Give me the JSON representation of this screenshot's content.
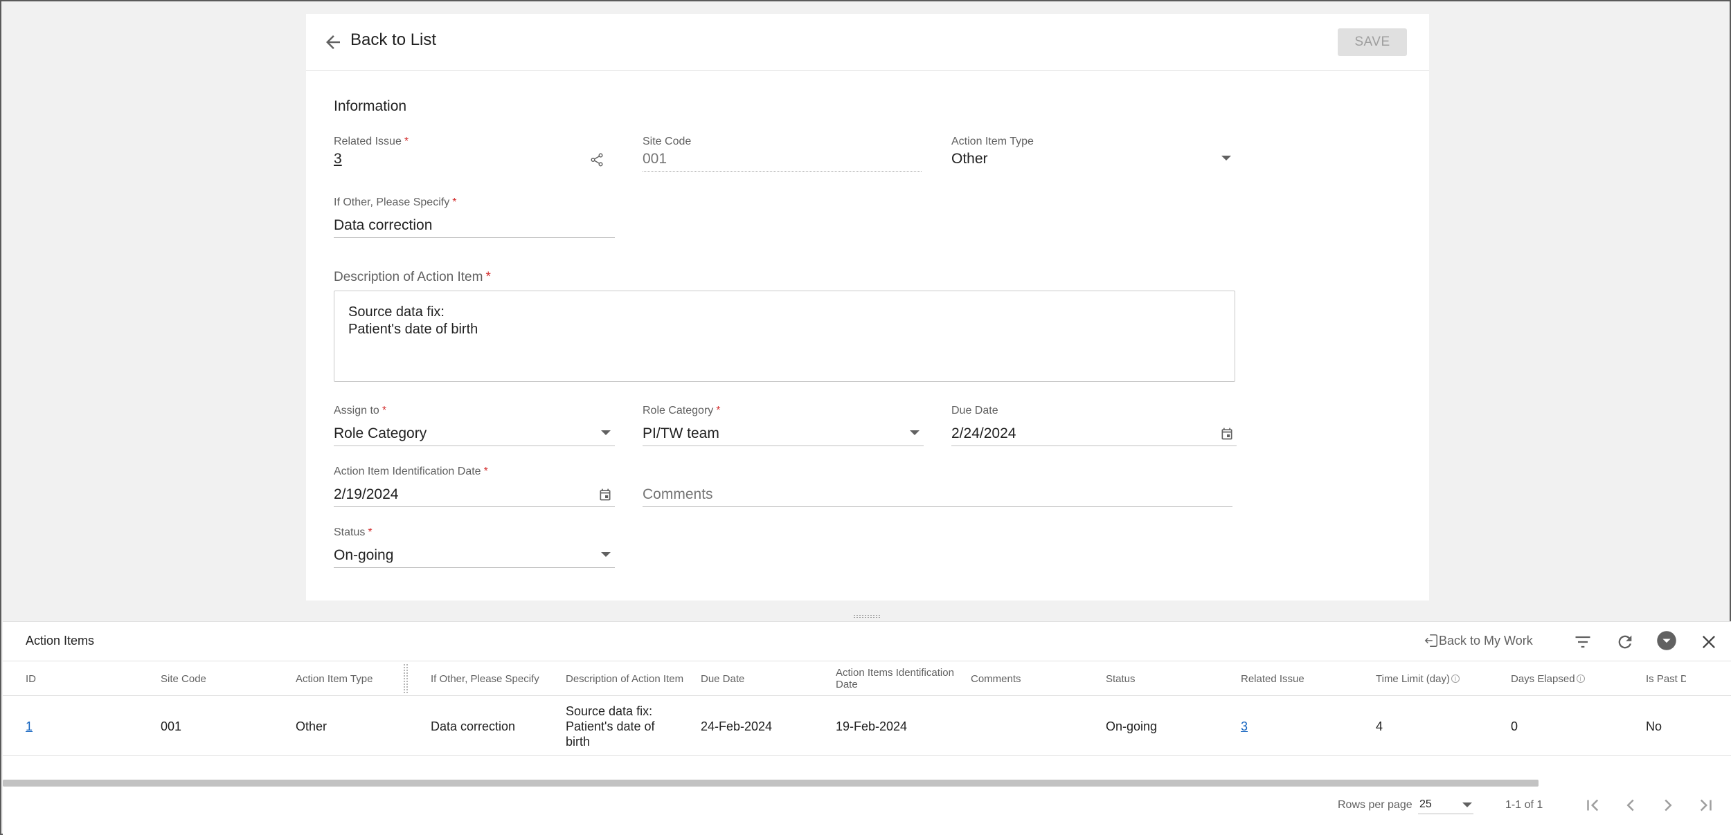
{
  "header": {
    "back_label": "Back to List",
    "save_label": "SAVE"
  },
  "form": {
    "section_title": "Information",
    "related_issue": {
      "label": "Related Issue",
      "value": "3"
    },
    "site_code": {
      "label": "Site Code",
      "value": "001"
    },
    "action_item_type": {
      "label": "Action Item Type",
      "value": "Other"
    },
    "if_other": {
      "label": "If Other, Please Specify",
      "value": "Data correction"
    },
    "description": {
      "label": "Description of Action Item",
      "line1": "Source data fix:",
      "line2": "Patient's date of birth"
    },
    "assign_to": {
      "label": "Assign to",
      "value": "Role Category"
    },
    "role_category": {
      "label": "Role Category",
      "value": "PI/TW team"
    },
    "due_date": {
      "label": "Due Date",
      "value": "2/24/2024"
    },
    "identification_date": {
      "label": "Action Item Identification Date",
      "value": "2/19/2024"
    },
    "comments": {
      "placeholder": "Comments"
    },
    "status": {
      "label": "Status",
      "value": "On-going"
    },
    "required_mark": "*"
  },
  "panel": {
    "title": "Action Items",
    "back_to_my_work": "Back to My Work",
    "columns": [
      "ID",
      "Site Code",
      "Action Item Type",
      "If Other, Please Specify",
      "Description of Action Item",
      "Due Date",
      "Action Items Identification Date",
      "Comments",
      "Status",
      "Related Issue",
      "Time Limit (day)",
      "Days Elapsed",
      "Is Past D"
    ],
    "rows": [
      {
        "id": "1",
        "site_code": "001",
        "action_item_type": "Other",
        "if_other": "Data correction",
        "description": "Source data fix: Patient's date of birth",
        "due_date": "24-Feb-2024",
        "identification_date": "19-Feb-2024",
        "comments": "",
        "status": "On-going",
        "related_issue": "3",
        "time_limit": "4",
        "days_elapsed": "0",
        "is_past_due": "No"
      }
    ],
    "rows_per_page_label": "Rows per page",
    "rows_per_page": "25",
    "range": "1-1 of 1",
    "info_glyph": "i"
  },
  "colors": {
    "link": "#1565c0",
    "required": "#d32f2f",
    "background": "#f1f1f1"
  }
}
